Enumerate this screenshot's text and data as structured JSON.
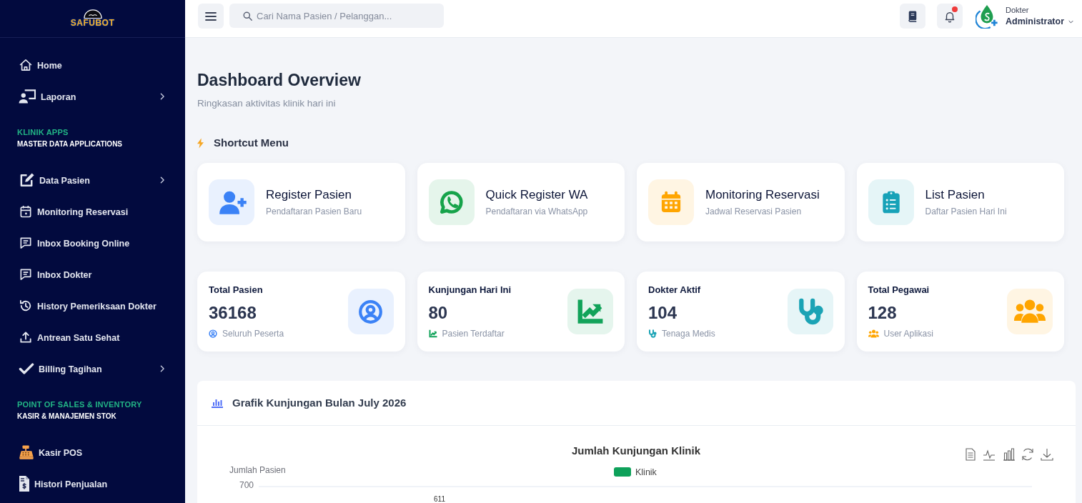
{
  "sidebar": {
    "logo_text": "SAFUBOT",
    "sections": [
      {
        "items": [
          {
            "label": "Home",
            "has_submenu": false
          },
          {
            "label": "Laporan",
            "has_submenu": true
          }
        ]
      },
      {
        "title": "KLINIK APPS",
        "subtitle": "MASTER DATA APPLICATIONS",
        "items": [
          {
            "label": "Data Pasien",
            "has_submenu": true
          },
          {
            "label": "Monitoring Reservasi",
            "has_submenu": false
          },
          {
            "label": "Inbox Booking Online",
            "has_submenu": false
          },
          {
            "label": "Inbox Dokter",
            "has_submenu": false
          },
          {
            "label": "History Pemeriksaan Dokter",
            "has_submenu": false
          },
          {
            "label": "Antrean Satu Sehat",
            "has_submenu": false
          },
          {
            "label": "Billing Tagihan",
            "has_submenu": true
          }
        ]
      },
      {
        "title": "POINT OF SALES & INVENTORY",
        "subtitle": "KASIR & MANAJEMEN STOK",
        "items": [
          {
            "label": "Kasir POS",
            "has_submenu": false
          },
          {
            "label": "Histori Penjualan",
            "has_submenu": false
          }
        ]
      }
    ]
  },
  "topbar": {
    "search": {
      "placeholder": "Cari Nama Pasien / Pelanggan..."
    },
    "notifications": {
      "unread": true
    },
    "user": {
      "role": "Dokter",
      "name": "Administrator"
    }
  },
  "header": {
    "title": "Dashboard Overview",
    "subtitle": "Ringkasan aktivitas klinik hari ini"
  },
  "shortcuts": {
    "title": "Shortcut Menu",
    "items": [
      {
        "title": "Register Pasien",
        "subtitle": "Pendaftaran Pasien Baru",
        "color": "#3b82f6"
      },
      {
        "title": "Quick Register WA",
        "subtitle": "Pendaftaran via WhatsApp",
        "color": "#16a34a"
      },
      {
        "title": "Monitoring Reservasi",
        "subtitle": "Jadwal Reservasi Pasien",
        "color": "#ffa500"
      },
      {
        "title": "List Pasien",
        "subtitle": "Daftar Pasien Hari Ini",
        "color": "#17a2b8"
      }
    ]
  },
  "stats": [
    {
      "label": "Total Pasien",
      "value": "36168",
      "note": "Seluruh Peserta",
      "color": "#3b82f6"
    },
    {
      "label": "Kunjungan Hari Ini",
      "value": "80",
      "note": "Pasien Terdaftar",
      "color": "#12a35a"
    },
    {
      "label": "Dokter Aktif",
      "value": "104",
      "note": "Tenaga Medis",
      "color": "#1ba3b5"
    },
    {
      "label": "Total Pegawai",
      "value": "128",
      "note": "User Aplikasi",
      "color": "#ffa500"
    }
  ],
  "chart_panel": {
    "title": "Grafik Kunjungan Bulan July 2026",
    "chart_title": "Jumlah Kunjungan Klinik",
    "legend": [
      {
        "label": "Klinik",
        "color": "#0ea15a"
      }
    ],
    "y_axis_title": "Jumlah Pasien",
    "y_tick": "700",
    "data_label": "611"
  }
}
